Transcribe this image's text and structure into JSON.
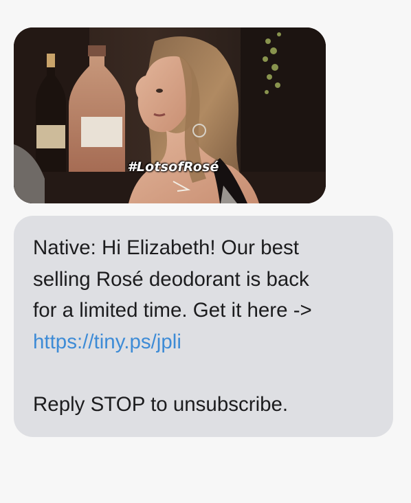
{
  "messages": {
    "gif": {
      "caption": "#LotsofRosé"
    },
    "text": {
      "line1": "Native: Hi Elizabeth! Our best",
      "line2": "selling Rosé deodorant is back",
      "line3": "for a limited time. Get it here ->",
      "link": "https://tiny.ps/jpli",
      "footer": "Reply STOP to unsubscribe."
    }
  },
  "colors": {
    "background": "#f7f7f7",
    "bubble": "#dedfe3",
    "text": "#1c1c1e",
    "link": "#3d8bd6"
  }
}
